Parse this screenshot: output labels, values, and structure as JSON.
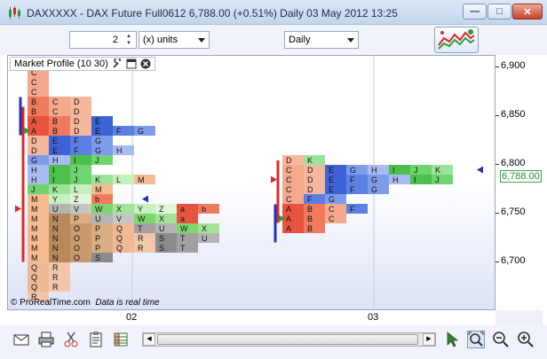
{
  "window": {
    "title": "DAXXXXX - DAX Future Full0612  6,788.00 (+0.51%)   Daily  03 May 2012 13:25",
    "minimize_glyph": "—",
    "maximize_glyph": "□",
    "close_glyph": "✕"
  },
  "toolbar": {
    "units_value": "2",
    "units_type": "(x) units",
    "period": "Daily"
  },
  "panel": {
    "title": "Market Profile (10 30)"
  },
  "footer": {
    "copyright": "© ProRealTime.com",
    "realtime": "Data is real time"
  },
  "price_axis": {
    "ticks": [
      "6,900",
      "6,850",
      "6,800",
      "6,750",
      "6,700"
    ],
    "last_price": "6,788.00",
    "range": [
      6680,
      6915
    ]
  },
  "time_axis": {
    "labels": [
      "02",
      "03"
    ]
  },
  "colors": {
    "last_price_text": "#2b8a36",
    "value_area": "#e0282a",
    "initial_balance": "#2233bb"
  },
  "icons": {
    "app": "candlestick-icon",
    "indicator": "indicator-chart-icon",
    "bottom": [
      "envelope-icon",
      "printer-icon",
      "scissors-icon",
      "clipboard-icon",
      "spreadsheet-icon",
      "scroll-left-icon",
      "scroll-right-icon",
      "cursor-icon",
      "zoom-fit-icon",
      "zoom-out-icon",
      "zoom-in-icon"
    ]
  },
  "chart_data": {
    "type": "table",
    "title": "Market Profile (10 30)",
    "ylim": [
      6680,
      6915
    ],
    "profiles": [
      {
        "day": "02",
        "rows": [
          {
            "price": 6895,
            "letters": [
              "C"
            ]
          },
          {
            "price": 6885,
            "letters": [
              "C"
            ]
          },
          {
            "price": 6875,
            "letters": [
              "C"
            ]
          },
          {
            "price": 6865,
            "letters": [
              "B",
              "C",
              "D"
            ]
          },
          {
            "price": 6855,
            "letters": [
              "B",
              "C",
              "D"
            ]
          },
          {
            "price": 6845,
            "letters": [
              "A",
              "B",
              "D",
              "E"
            ]
          },
          {
            "price": 6835,
            "letters": [
              "A",
              "B",
              "D",
              "E",
              "F",
              "G"
            ]
          },
          {
            "price": 6825,
            "letters": [
              "D",
              "E",
              "F",
              "G"
            ]
          },
          {
            "price": 6815,
            "letters": [
              "D",
              "E",
              "F",
              "G",
              "H"
            ]
          },
          {
            "price": 6805,
            "letters": [
              "G",
              "H",
              "I",
              "J"
            ]
          },
          {
            "price": 6795,
            "letters": [
              "H",
              "I",
              "J"
            ]
          },
          {
            "price": 6785,
            "letters": [
              "H",
              "I",
              "J",
              "K",
              "L",
              "M"
            ]
          },
          {
            "price": 6775,
            "letters": [
              "J",
              "K",
              "L",
              "M"
            ]
          },
          {
            "price": 6765,
            "letters": [
              "M",
              "Y",
              "Z",
              "b"
            ]
          },
          {
            "price": 6755,
            "letters": [
              "M",
              "U",
              "V",
              "W",
              "X",
              "Y",
              "Z",
              "a",
              "b"
            ]
          },
          {
            "price": 6745,
            "letters": [
              "M",
              "N",
              "P",
              "U",
              "V",
              "W",
              "X",
              "a"
            ]
          },
          {
            "price": 6735,
            "letters": [
              "M",
              "N",
              "O",
              "P",
              "Q",
              "T",
              "U",
              "W",
              "X"
            ]
          },
          {
            "price": 6725,
            "letters": [
              "M",
              "N",
              "O",
              "P",
              "Q",
              "R",
              "S",
              "T",
              "U"
            ]
          },
          {
            "price": 6715,
            "letters": [
              "M",
              "N",
              "O",
              "P",
              "Q",
              "R",
              "S",
              "T"
            ]
          },
          {
            "price": 6705,
            "letters": [
              "M",
              "N",
              "O",
              "S"
            ]
          },
          {
            "price": 6695,
            "letters": [
              "Q",
              "R"
            ]
          },
          {
            "price": 6685,
            "letters": [
              "Q",
              "R"
            ]
          },
          {
            "price": 6675,
            "letters": [
              "Q",
              "R"
            ]
          },
          {
            "price": 6665,
            "letters": [
              "R"
            ]
          }
        ]
      },
      {
        "day": "03",
        "rows": [
          {
            "price": 6805,
            "letters": [
              "D",
              "K"
            ]
          },
          {
            "price": 6795,
            "letters": [
              "C",
              "D",
              "E",
              "G",
              "H",
              "I",
              "J",
              "K"
            ]
          },
          {
            "price": 6785,
            "letters": [
              "C",
              "D",
              "E",
              "F",
              "G",
              "H",
              "I",
              "J"
            ]
          },
          {
            "price": 6775,
            "letters": [
              "C",
              "D",
              "E",
              "F",
              "G"
            ]
          },
          {
            "price": 6765,
            "letters": [
              "C",
              "F",
              "G"
            ]
          },
          {
            "price": 6755,
            "letters": [
              "A",
              "B",
              "C",
              "F"
            ]
          },
          {
            "price": 6745,
            "letters": [
              "A",
              "B",
              "C"
            ]
          },
          {
            "price": 6735,
            "letters": [
              "A",
              "B"
            ]
          }
        ]
      }
    ]
  }
}
